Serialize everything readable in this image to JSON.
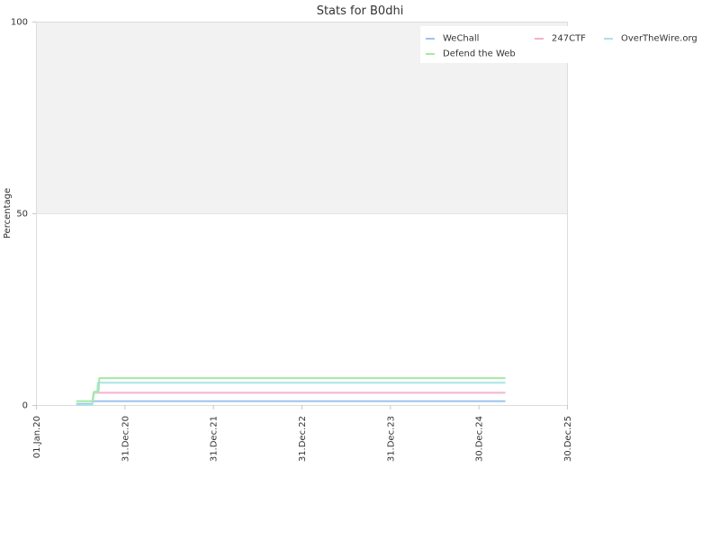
{
  "chart_data": {
    "type": "line",
    "title": "Stats for B0dhi",
    "xlabel": "",
    "ylabel": "Percentage",
    "xlim": [
      "2020-01-01",
      "2025-12-30"
    ],
    "ylim": [
      0,
      100
    ],
    "x_ticks": [
      "01.Jan.20",
      "31.Dec.20",
      "31.Dec.21",
      "31.Dec.22",
      "31.Dec.23",
      "30.Dec.24",
      "30.Dec.25"
    ],
    "y_ticks": [
      "0",
      "50",
      "100"
    ],
    "grid": false,
    "bands": [
      {
        "from": 0,
        "to": 50,
        "color": "#ffffff"
      },
      {
        "from": 50,
        "to": 100,
        "color": "#f2f2f2"
      }
    ],
    "legend_position": "top-right",
    "series": [
      {
        "name": "WeChall",
        "color": "#9cc5ec",
        "points": [
          [
            "2020-06-15",
            0.3
          ],
          [
            "2020-08-20",
            0.3
          ],
          [
            "2020-08-25",
            1.0
          ],
          [
            "2025-04-20",
            1.0
          ]
        ]
      },
      {
        "name": "247CTF",
        "color": "#f4b2cf",
        "points": [
          [
            "2020-08-20",
            0.0
          ],
          [
            "2020-08-25",
            3.2
          ],
          [
            "2025-04-20",
            3.2
          ]
        ]
      },
      {
        "name": "OverTheWire.org",
        "color": "#a8e4e6",
        "points": [
          [
            "2020-06-15",
            0.0
          ],
          [
            "2020-08-20",
            0.0
          ],
          [
            "2020-08-28",
            3.3
          ],
          [
            "2020-09-10",
            3.3
          ],
          [
            "2020-09-12",
            5.8
          ],
          [
            "2025-04-20",
            5.8
          ]
        ]
      },
      {
        "name": "Defend the Web",
        "color": "#a6e8a3",
        "points": [
          [
            "2020-06-15",
            1.0
          ],
          [
            "2020-08-20",
            1.0
          ],
          [
            "2020-08-28",
            3.5
          ],
          [
            "2020-09-15",
            3.5
          ],
          [
            "2020-09-18",
            7.0
          ],
          [
            "2025-04-20",
            7.0
          ]
        ]
      }
    ],
    "legend_order": [
      "WeChall",
      "247CTF",
      "OverTheWire.org",
      "Defend the Web"
    ]
  }
}
